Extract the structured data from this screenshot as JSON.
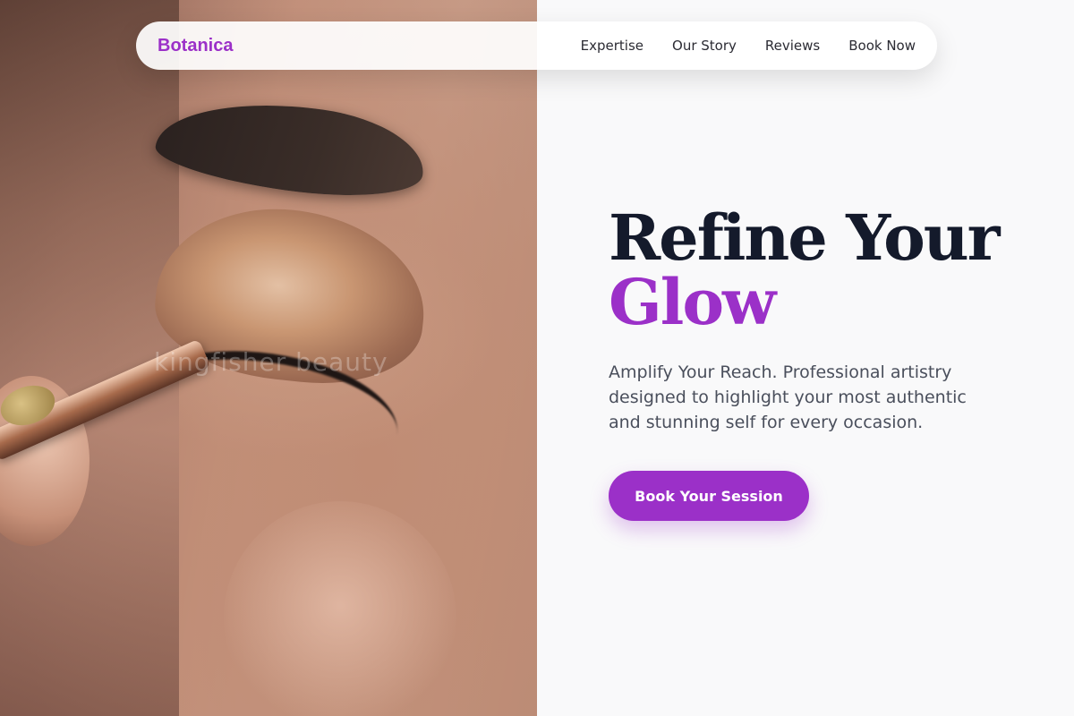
{
  "brand": {
    "name": "Botanica",
    "color": "#9b30c8"
  },
  "nav": {
    "links": [
      "Expertise",
      "Our Story",
      "Reviews",
      "Book Now"
    ]
  },
  "hero": {
    "title_line1": "Refine Your",
    "title_line2": "Glow",
    "subtitle": "Amplify Your Reach. Professional artistry designed to highlight your most authentic and stunning self for every occasion.",
    "cta_label": "Book Your Session",
    "image_watermark": "kingfisher beauty"
  },
  "colors": {
    "accent": "#9b30c8",
    "title": "#141a2b",
    "text": "#4a4f5c",
    "background": "#f9f9fa"
  }
}
